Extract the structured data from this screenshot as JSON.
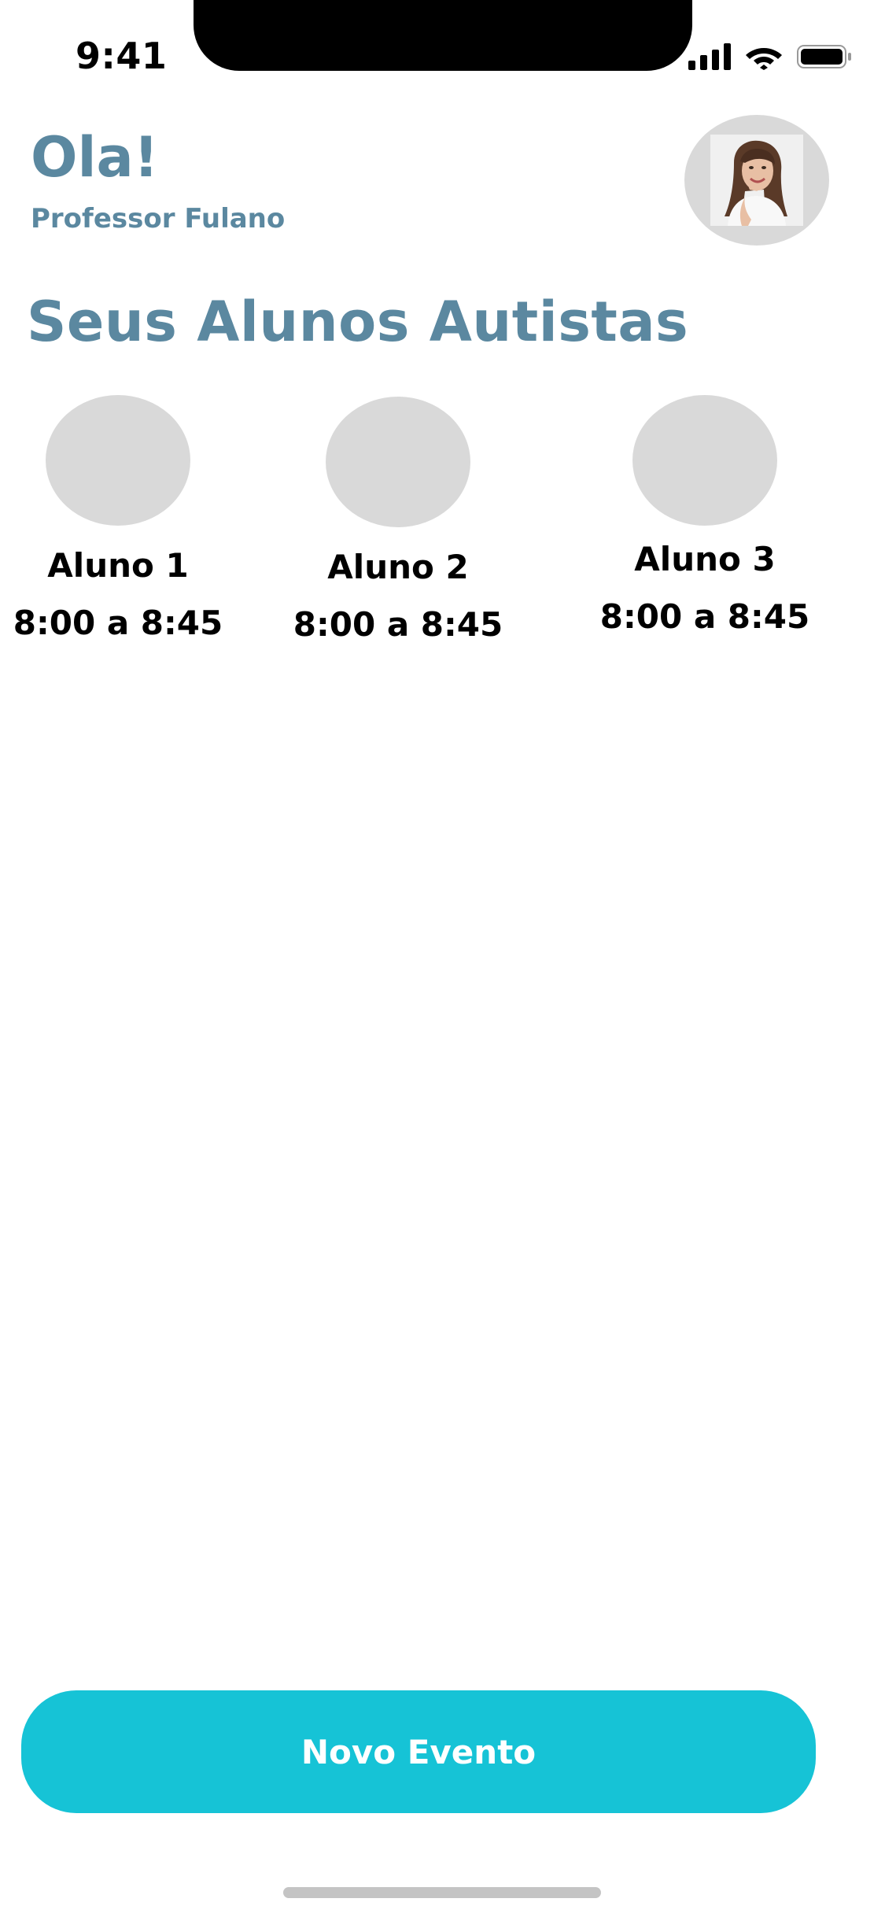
{
  "status_bar": {
    "time": "9:41",
    "icons": [
      "signal-icon",
      "wifi-icon",
      "battery-icon"
    ]
  },
  "header": {
    "greeting": "Ola!",
    "subtitle": "Professor Fulano",
    "avatar": "teacher-photo"
  },
  "students_section": {
    "title": "Seus Alunos Autistas",
    "students": [
      {
        "name": "Aluno 1",
        "time": "8:00 a 8:45"
      },
      {
        "name": "Aluno 2",
        "time": "8:00 a 8:45"
      },
      {
        "name": "Aluno 3",
        "time": "8:00 a 8:45"
      }
    ]
  },
  "actions": {
    "new_event_label": "Novo Evento"
  },
  "colors": {
    "accent": "#5b88a0",
    "button": "#16c3d6",
    "placeholder": "#d9d9d9"
  }
}
